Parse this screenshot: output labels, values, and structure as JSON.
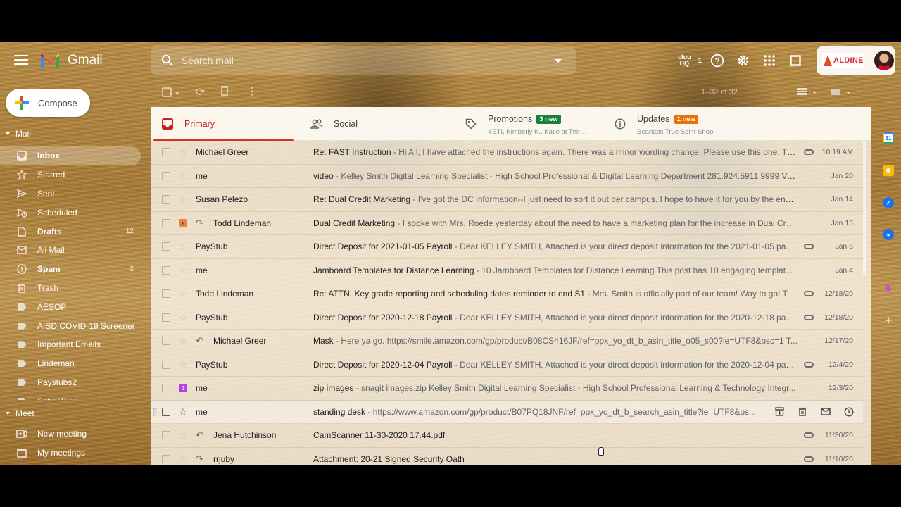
{
  "app": {
    "name": "Gmail",
    "search_placeholder": "Search mail"
  },
  "header_icons": [
    {
      "name": "cloudhq-icon",
      "label": "cloud HQ",
      "badge": "1"
    },
    {
      "name": "help-icon"
    },
    {
      "name": "settings-icon"
    },
    {
      "name": "apps-icon"
    },
    {
      "name": "window-icon"
    }
  ],
  "account": {
    "org_logo_text": "ALDINE",
    "avatar": "user-avatar"
  },
  "toolbar": {
    "pager": "1–32 of 32"
  },
  "compose": {
    "label": "Compose"
  },
  "sidebar": {
    "mail_section": "Mail",
    "items": [
      {
        "label": "Inbox",
        "icon": "inbox-icon",
        "active": true,
        "bold": true,
        "count": ""
      },
      {
        "label": "Starred",
        "icon": "star-icon",
        "count": ""
      },
      {
        "label": "Sent",
        "icon": "send-icon",
        "count": ""
      },
      {
        "label": "Scheduled",
        "icon": "scheduled-icon",
        "count": ""
      },
      {
        "label": "Drafts",
        "icon": "draft-icon",
        "bold": true,
        "count": "12"
      },
      {
        "label": "All Mail",
        "icon": "all-mail-icon",
        "count": ""
      },
      {
        "label": "Spam",
        "icon": "spam-icon",
        "bold": true,
        "count": "2"
      },
      {
        "label": "Trash",
        "icon": "trash-icon",
        "count": ""
      },
      {
        "label": "AESOP",
        "icon": "label-icon",
        "count": ""
      },
      {
        "label": "AISD COVID-19 Screener",
        "icon": "label-icon",
        "count": ""
      },
      {
        "label": "Important Emails",
        "icon": "label-icon",
        "count": ""
      },
      {
        "label": "Lindeman",
        "icon": "label-icon",
        "count": ""
      },
      {
        "label": "Paystubs2",
        "icon": "label-icon",
        "count": ""
      },
      {
        "label": "Schoology",
        "icon": "label-icon",
        "count": ""
      }
    ],
    "meet_section": "Meet",
    "meet_items": [
      {
        "label": "New meeting",
        "icon": "video-add-icon"
      },
      {
        "label": "My meetings",
        "icon": "calendar-icon"
      }
    ]
  },
  "tabs": [
    {
      "label": "Primary",
      "icon": "inbox-icon",
      "active": true
    },
    {
      "label": "Social",
      "icon": "people-icon"
    },
    {
      "label": "Promotions",
      "icon": "tag-icon",
      "badge": "3 new",
      "badge_color": "#188038",
      "subtitle": "YETI, Kimberly K., Katie at Thir…"
    },
    {
      "label": "Updates",
      "icon": "info-icon",
      "badge": "1 new",
      "badge_color": "#e8710a",
      "subtitle": "Bearkats True Spirit Shop"
    }
  ],
  "emails": [
    {
      "sender": "Michael Greer",
      "subject": "Re: FAST Instruction",
      "snippet": " - Hi All, I have attached the instructions again. There was a minor wording change. Please use this one. Th...",
      "date": "10:19 AM",
      "attachment": true,
      "marker": "star",
      "thread": ""
    },
    {
      "sender": "me",
      "subject": "video",
      "snippet": " - Kelley Smith Digital Learning Specialist - High School Professional & Digital Learning Department 281.924.5911 9999 Ve...",
      "date": "Jan 20",
      "attachment": false,
      "marker": "star",
      "thread": ""
    },
    {
      "sender": "Susan Pelezo",
      "subject": "Re: Dual Credit Marketing",
      "snippet": " - I've got the DC information--I just need to sort it out per campus. I hope to have it for you by the end ...",
      "date": "Jan 14",
      "attachment": false,
      "marker": "star",
      "thread": ""
    },
    {
      "sender": "Todd Lindeman",
      "subject": "Dual Credit Marketing",
      "snippet": " - I spoke with Mrs. Roede yesterday about the need to have a marketing plan for the increase in Dual Cre...",
      "date": "Jan 13",
      "attachment": false,
      "marker": "orange-guillemet",
      "thread": "forwarded"
    },
    {
      "sender": "PayStub",
      "subject": "Direct Deposit for 2021-01-05 Payroll",
      "snippet": " - Dear KELLEY SMITH, Attached is your direct deposit information for the 2021-01-05 payr...",
      "date": "Jan 5",
      "attachment": true,
      "marker": "star",
      "thread": ""
    },
    {
      "sender": "me",
      "subject": "Jamboard Templates for Distance Learning",
      "snippet": " - 10 Jamboard Templates for Distance Learning This post has 10 engaging templat...",
      "date": "Jan 4",
      "attachment": false,
      "marker": "star",
      "thread": ""
    },
    {
      "sender": "Todd Lindeman",
      "subject": "Re: ATTN: Key grade reporting and scheduling dates reminder to end S1",
      "snippet": " - Mrs. Smith is officially part of our team! Way to go! T...",
      "date": "12/18/20",
      "attachment": true,
      "marker": "star",
      "thread": ""
    },
    {
      "sender": "PayStub",
      "subject": "Direct Deposit for 2020-12-18 Payroll",
      "snippet": " - Dear KELLEY SMITH, Attached is your direct deposit information for the 2020-12-18 payr...",
      "date": "12/18/20",
      "attachment": true,
      "marker": "star",
      "thread": ""
    },
    {
      "sender": "Michael Greer",
      "subject": "Mask",
      "snippet": " - Here ya go. https://smile.amazon.com/gp/product/B08CS416JF/ref=ppx_yo_dt_b_asin_title_o05_s00?ie=UTF8&psc=1 T...",
      "date": "12/17/20",
      "attachment": false,
      "marker": "star",
      "thread": "replied"
    },
    {
      "sender": "PayStub",
      "subject": "Direct Deposit for 2020-12-04 Payroll",
      "snippet": " - Dear KELLEY SMITH, Attached is your direct deposit information for the 2020-12-04 payr...",
      "date": "12/4/20",
      "attachment": true,
      "marker": "star",
      "thread": ""
    },
    {
      "sender": "me",
      "subject": "zip images",
      "snippet": " - snagit images.zip Kelley Smith Digital Learning Specialist - High School Professional Learning & Technology Integr...",
      "date": "12/3/20",
      "attachment": false,
      "marker": "purple-question",
      "thread": ""
    },
    {
      "sender": "me",
      "subject": "standing desk",
      "snippet": " - https://www.amazon.com/gp/product/B07PQ18JNF/ref=ppx_yo_dt_b_search_asin_title?ie=UTF8&ps...",
      "date": "",
      "attachment": false,
      "marker": "star",
      "thread": "",
      "hover": true
    },
    {
      "sender": "Jena Hutchinson",
      "subject": "CamScanner 11-30-2020 17.44.pdf",
      "snippet": "",
      "date": "11/30/20",
      "attachment": true,
      "marker": "star",
      "thread": "replied"
    },
    {
      "sender": "rrjuby",
      "subject": "Attachment: 20-21 Signed Security Oath",
      "snippet": "",
      "date": "11/10/20",
      "attachment": true,
      "marker": "star",
      "thread": "forwarded"
    }
  ],
  "hover_actions": [
    "archive-icon",
    "delete-icon",
    "mark-unread-icon",
    "snooze-icon"
  ],
  "side_panel": [
    {
      "name": "calendar-app-icon",
      "label": "31",
      "color": "#4285f4"
    },
    {
      "name": "keep-app-icon",
      "color": "#fbbc04"
    },
    {
      "name": "tasks-app-icon",
      "color": "#1a73e8"
    },
    {
      "name": "contacts-app-icon",
      "color": "#1a73e8"
    },
    {
      "name": "unicorn-addon-icon",
      "color": "#c94fd0"
    },
    {
      "name": "add-addon-icon"
    }
  ]
}
